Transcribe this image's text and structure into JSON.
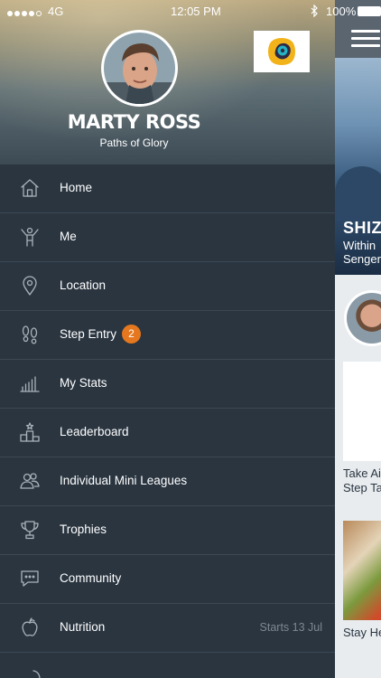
{
  "status_bar": {
    "carrier": "4G",
    "time": "12:05 PM",
    "battery": "100%"
  },
  "profile": {
    "name": "MARTY ROSS",
    "subtitle": "Paths of Glory"
  },
  "menu": {
    "items": [
      {
        "label": "Home",
        "icon": "home-icon"
      },
      {
        "label": "Me",
        "icon": "person-icon"
      },
      {
        "label": "Location",
        "icon": "location-pin-icon"
      },
      {
        "label": "Step Entry",
        "icon": "footprints-icon",
        "badge": "2"
      },
      {
        "label": "My Stats",
        "icon": "bar-chart-icon"
      },
      {
        "label": "Leaderboard",
        "icon": "podium-icon"
      },
      {
        "label": "Individual Mini Leagues",
        "icon": "people-icon"
      },
      {
        "label": "Trophies",
        "icon": "trophy-icon"
      },
      {
        "label": "Community",
        "icon": "chat-bubble-icon"
      },
      {
        "label": "Nutrition",
        "icon": "apple-icon",
        "note": "Starts 13 Jul"
      }
    ]
  },
  "main": {
    "hero_title": "SHIZUC",
    "hero_sub_line1": "Within",
    "hero_sub_line2": "Senger",
    "card1_line1": "Take Ai",
    "card1_line2": "Step Ta",
    "card2_line1": "Stay He"
  },
  "colors": {
    "drawer_bg": "#2a3540",
    "badge": "#e5771e",
    "divider": "#3c4853"
  }
}
